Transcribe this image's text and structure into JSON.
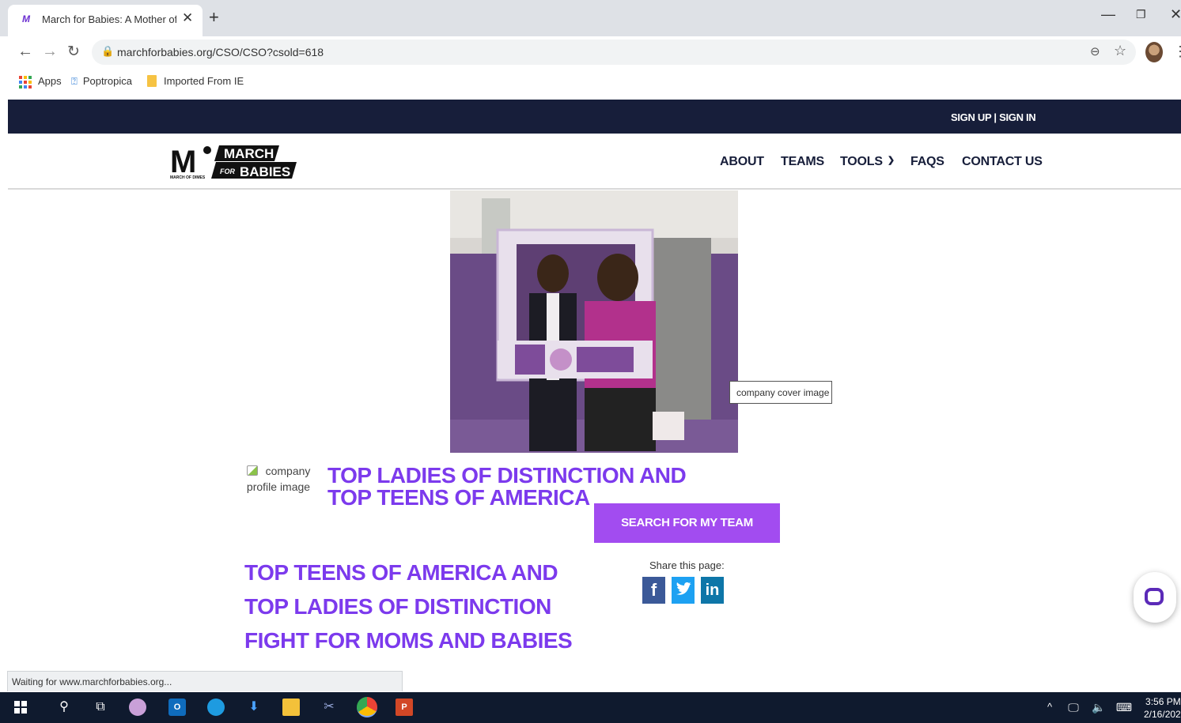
{
  "browser": {
    "tab_title": "March for Babies: A Mother of A",
    "tab_favicon_text": "M",
    "url": "marchforbabies.org/CSO/CSO?csold=618",
    "bookmarks": [
      {
        "label": "Apps",
        "icon": "apps-grid-icon"
      },
      {
        "label": "Poptropica",
        "icon": "poptropica-icon"
      },
      {
        "label": "Imported From IE",
        "icon": "folder-icon"
      }
    ],
    "status_text": "Waiting for www.marchforbabies.org..."
  },
  "site": {
    "auth_links": "SIGN UP | SIGN IN",
    "logo": {
      "mark": "M",
      "line1": "MARCH",
      "for": "FOR",
      "line2": "BABIES",
      "subtext": "MARCH OF DIMES"
    },
    "nav": [
      {
        "label": "ABOUT"
      },
      {
        "label": "TEAMS"
      },
      {
        "label": "TOOLS"
      },
      {
        "label": "FAQS"
      },
      {
        "label": "CONTACT US"
      }
    ],
    "cover_tooltip": "company cover image",
    "profile_image_alt": "company profile image",
    "team_name": "TOP LADIES OF DISTINCTION AND TOP TEENS OF AMERICA",
    "search_button": "SEARCH FOR MY TEAM",
    "headline": "TOP TEENS OF AMERICA AND TOP LADIES OF DISTINCTION FIGHT FOR MOMS AND BABIES",
    "share_label": "Share this page:",
    "share_buttons": [
      {
        "label": "f",
        "icon": "facebook-icon"
      },
      {
        "label": "t",
        "icon": "twitter-icon"
      },
      {
        "label": "in",
        "icon": "linkedin-icon"
      }
    ],
    "colors": {
      "brand_navy": "#171e3a",
      "brand_purple": "#7c3aed",
      "button_purple": "#a24cf0"
    }
  },
  "taskbar": {
    "time": "3:56 PM",
    "date": "2/16/202"
  }
}
